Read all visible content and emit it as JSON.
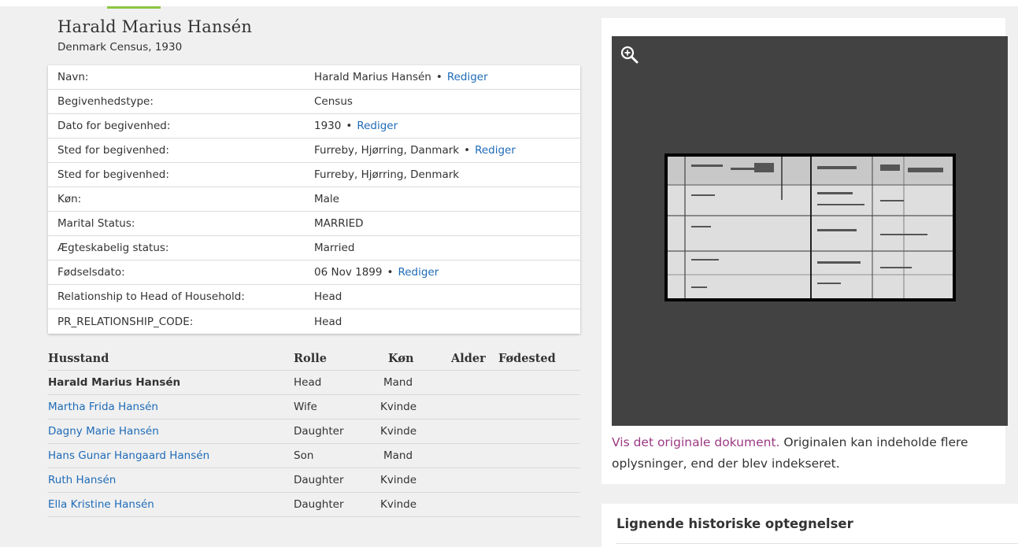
{
  "record": {
    "name": "Harald Marius Hansén",
    "collection": "Denmark Census, 1930"
  },
  "facts": [
    {
      "label": "Navn:",
      "value": "Harald Marius Hansén",
      "edit": "Rediger"
    },
    {
      "label": "Begivenhedstype:",
      "value": "Census",
      "edit": ""
    },
    {
      "label": "Dato for begivenhed:",
      "value": "1930",
      "edit": "Rediger"
    },
    {
      "label": "Sted for begivenhed:",
      "value": "Furreby, Hjørring, Danmark",
      "edit": "Rediger"
    },
    {
      "label": "Sted for begivenhed:",
      "value": "Furreby, Hjørring, Denmark",
      "edit": ""
    },
    {
      "label": "Køn:",
      "value": "Male",
      "edit": ""
    },
    {
      "label": "Marital Status:",
      "value": "MARRIED",
      "edit": ""
    },
    {
      "label": "Ægteskabelig status:",
      "value": "Married",
      "edit": ""
    },
    {
      "label": "Fødselsdato:",
      "value": "06 Nov 1899",
      "edit": "Rediger"
    },
    {
      "label": "Relationship to Head of Household:",
      "value": "Head",
      "edit": ""
    },
    {
      "label": "PR_RELATIONSHIP_CODE:",
      "value": "Head",
      "edit": ""
    }
  ],
  "household": {
    "headers": {
      "name": "Husstand",
      "role": "Rolle",
      "sex": "Køn",
      "age": "Alder",
      "place": "Fødested"
    },
    "rows": [
      {
        "name": "Harald Marius Hansén",
        "role": "Head",
        "sex": "Mand"
      },
      {
        "name": "Martha Frida Hansén",
        "role": "Wife",
        "sex": "Kvinde"
      },
      {
        "name": "Dagny Marie Hansén",
        "role": "Daughter",
        "sex": "Kvinde"
      },
      {
        "name": "Hans Gunar Hangaard Hansén",
        "role": "Son",
        "sex": "Mand"
      },
      {
        "name": "Ruth Hansén",
        "role": "Daughter",
        "sex": "Kvinde"
      },
      {
        "name": "Ella Kristine Hansén",
        "role": "Daughter",
        "sex": "Kvinde"
      }
    ]
  },
  "document": {
    "link_text": "Vis det originale dokument.",
    "note_text": " Originalen kan indeholde flere oplysninger, end der blev indekseret."
  },
  "similar": {
    "title": "Lignende historiske optegnelser"
  },
  "dot": "•",
  "colors": {
    "link": "#1e6bb8",
    "visited_link": "#9b3a82",
    "accent": "#8cc63f",
    "viewer_bg": "#424242"
  }
}
